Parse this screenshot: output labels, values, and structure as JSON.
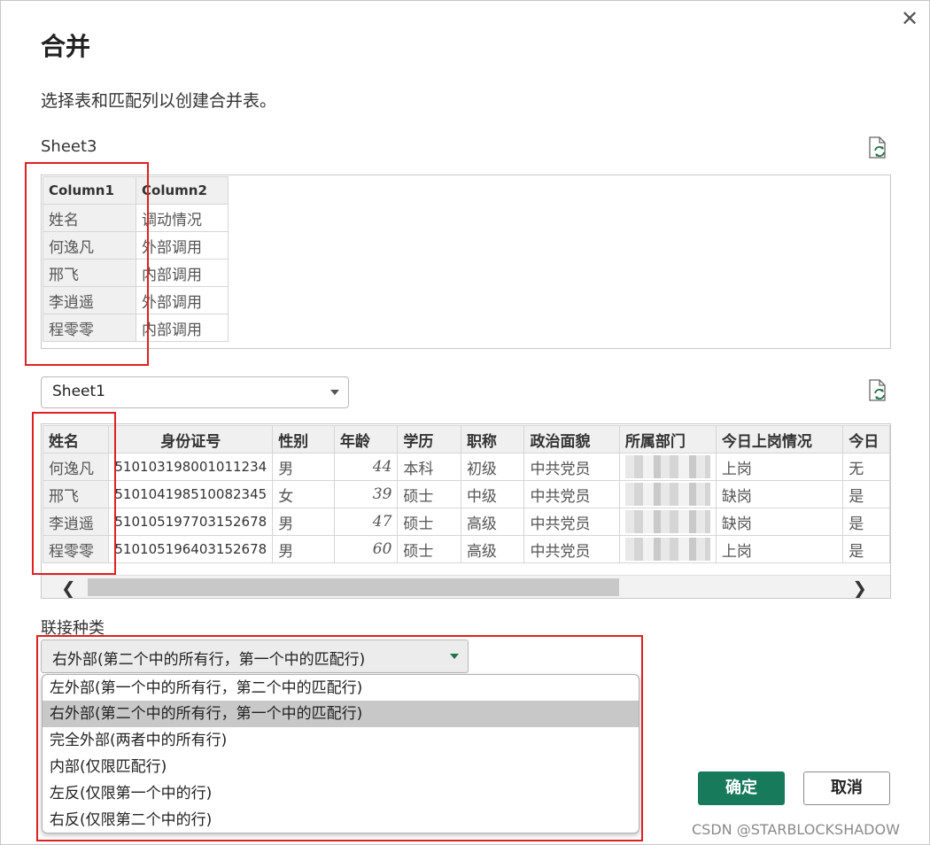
{
  "dialog": {
    "title": "合并",
    "description": "选择表和匹配列以创建合并表。",
    "close_icon": "close-icon"
  },
  "table1": {
    "name": "Sheet3",
    "columns": [
      "Column1",
      "Column2"
    ],
    "rows": [
      [
        "姓名",
        "调动情况"
      ],
      [
        "何逸凡",
        "外部调用"
      ],
      [
        "邢飞",
        "内部调用"
      ],
      [
        "李逍遥",
        "外部调用"
      ],
      [
        "程零零",
        "内部调用"
      ]
    ]
  },
  "table2": {
    "selected_sheet": "Sheet1",
    "columns": [
      "姓名",
      "身份证号",
      "性别",
      "年龄",
      "学历",
      "职称",
      "政治面貌",
      "所属部门",
      "今日上岗情况",
      "今日"
    ],
    "rows": [
      [
        "何逸凡",
        "510103198001011234",
        "男",
        "44",
        "本科",
        "初级",
        "中共党员",
        "",
        "上岗",
        "无"
      ],
      [
        "邢飞",
        "510104198510082345",
        "女",
        "39",
        "硕士",
        "中级",
        "中共党员",
        "",
        "缺岗",
        "是"
      ],
      [
        "李逍遥",
        "510105197703152678",
        "男",
        "47",
        "硕士",
        "高级",
        "中共党员",
        "",
        "缺岗",
        "是"
      ],
      [
        "程零零",
        "510105196403152678",
        "男",
        "60",
        "硕士",
        "高级",
        "中共党员",
        "",
        "上岗",
        "是"
      ]
    ],
    "scroll_left": "❮",
    "scroll_right": "❯"
  },
  "join": {
    "label": "联接种类",
    "selected": "右外部(第二个中的所有行，第一个中的匹配行)",
    "options": [
      "左外部(第一个中的所有行，第二个中的匹配行)",
      "右外部(第二个中的所有行，第一个中的匹配行)",
      "完全外部(两者中的所有行)",
      "内部(仅限匹配行)",
      "左反(仅限第一个中的行)",
      "右反(仅限第二个中的行)"
    ],
    "selected_index": 1
  },
  "buttons": {
    "ok": "确定",
    "cancel": "取消"
  },
  "watermark": "CSDN @STARBLOCKSHADOW",
  "colors": {
    "accent": "#177a5a",
    "highlight_border": "#e02020",
    "selected_option": "#c8c8c8"
  }
}
